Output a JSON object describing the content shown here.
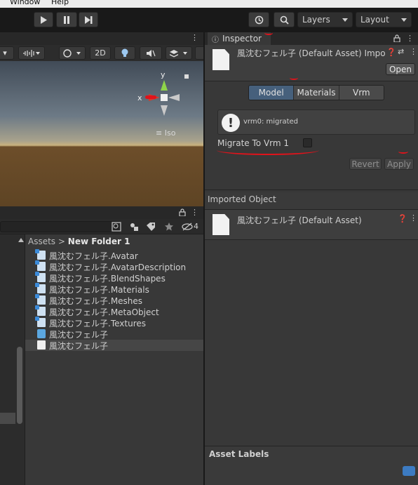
{
  "menubar": {
    "window": "Window",
    "help": "Help"
  },
  "toolbar": {
    "play_icon": "play-icon",
    "pause_icon": "pause-icon",
    "step_icon": "step-icon",
    "history_icon": "history-icon",
    "search_icon": "search-icon",
    "layers_label": "Layers",
    "layout_label": "Layout"
  },
  "scene": {
    "mode_2d": "2D",
    "gizmo": {
      "y": "y",
      "x": "x",
      "iso": "≡ Iso"
    }
  },
  "project": {
    "hidden_count": "4",
    "breadcrumb": {
      "root": "Assets",
      "separator": ">",
      "folder": "New Folder 1"
    },
    "items": [
      {
        "label": "風沈むフェル子.Avatar",
        "icon": "sub"
      },
      {
        "label": "風沈むフェル子.AvatarDescription",
        "icon": "sub"
      },
      {
        "label": "風沈むフェル子.BlendShapes",
        "icon": "sub"
      },
      {
        "label": "風沈むフェル子.Materials",
        "icon": "sub"
      },
      {
        "label": "風沈むフェル子.Meshes",
        "icon": "sub"
      },
      {
        "label": "風沈むフェル子.MetaObject",
        "icon": "sub"
      },
      {
        "label": "風沈むフェル子.Textures",
        "icon": "sub"
      },
      {
        "label": "風沈むフェル子",
        "icon": "prefab"
      },
      {
        "label": "風沈むフェル子",
        "icon": "doc",
        "selected": true
      }
    ]
  },
  "inspector": {
    "tab_label": "Inspector",
    "header_title": "風沈むフェル子 (Default Asset) Impo",
    "open_button": "Open",
    "tabs": [
      "Model",
      "Materials",
      "Vrm"
    ],
    "active_tab": "Model",
    "info_message": "vrm0: migrated",
    "migrate_label": "Migrate To Vrm 1",
    "migrate_checked": false,
    "revert_button": "Revert",
    "apply_button": "Apply",
    "imported_object_header": "Imported Object",
    "imported_title": "風沈むフェル子 (Default Asset)",
    "asset_labels_header": "Asset Labels"
  },
  "colors": {
    "annotation_red": "#e0131b",
    "active_tab": "#46607c",
    "selection": "#464646"
  }
}
